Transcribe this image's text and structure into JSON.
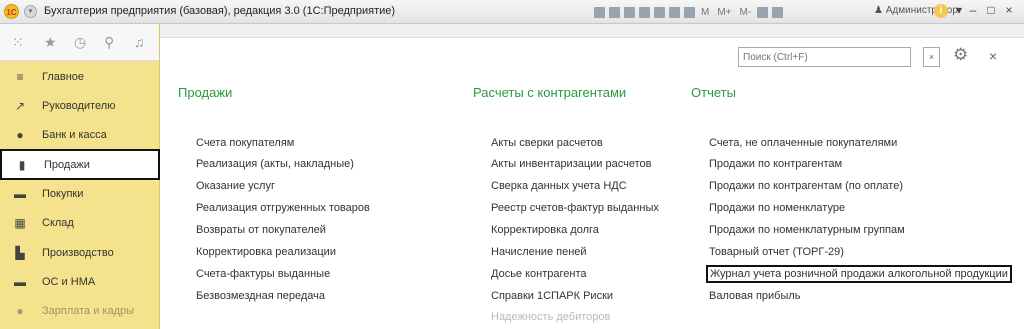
{
  "window": {
    "title": "Бухгалтерия предприятия (базовая), редакция 3.0  (1С:Предприятие)",
    "logo_text": "1С",
    "toolbar_text": [
      "M",
      "M+",
      "M-"
    ],
    "user": "Администратор",
    "info": "i",
    "controls": [
      "▾",
      "–",
      "□",
      "×"
    ]
  },
  "sidebar": {
    "top_icons": [
      "apps-icon",
      "star-icon",
      "history-icon",
      "search-icon",
      "bell-icon"
    ],
    "items": [
      {
        "label": "Главное",
        "icon": "≡"
      },
      {
        "label": "Руководителю",
        "icon": "↗"
      },
      {
        "label": "Банк и касса",
        "icon": "●"
      },
      {
        "label": "Продажи",
        "icon": "▮",
        "active": true
      },
      {
        "label": "Покупки",
        "icon": "▬"
      },
      {
        "label": "Склад",
        "icon": "▦"
      },
      {
        "label": "Производство",
        "icon": "▙"
      },
      {
        "label": "ОС и НМА",
        "icon": "▬"
      },
      {
        "label": "Зарплата и кадры",
        "icon": "●"
      }
    ]
  },
  "search": {
    "placeholder": "Поиск (Ctrl+F)",
    "clear": "×"
  },
  "columns": [
    {
      "heading": "Продажи",
      "links": [
        "Счета покупателям",
        "Реализация (акты, накладные)",
        "Оказание услуг",
        "Реализация отгруженных товаров",
        "Возвраты от покупателей",
        "Корректировка реализации",
        "Счета-фактуры выданные",
        "Безвозмездная передача"
      ]
    },
    {
      "heading": "Расчеты с контрагентами",
      "links": [
        "Акты сверки расчетов",
        "Акты инвентаризации расчетов",
        "Сверка данных учета НДС",
        "Реестр счетов-фактур выданных",
        "Корректировка долга",
        "Начисление пеней",
        "Досье контрагента",
        "Справки 1СПАРК Риски",
        "Надежность дебиторов"
      ]
    },
    {
      "heading": "Отчеты",
      "links": [
        "Счета, не оплаченные покупателями",
        "Продажи по контрагентам",
        "Продажи по контрагентам (по оплате)",
        "Продажи по номенклатуре",
        "Продажи по номенклатурным группам",
        "Товарный отчет (ТОРГ-29)",
        "Журнал учета розничной продажи алкогольной продукции",
        "Валовая прибыль"
      ]
    }
  ]
}
